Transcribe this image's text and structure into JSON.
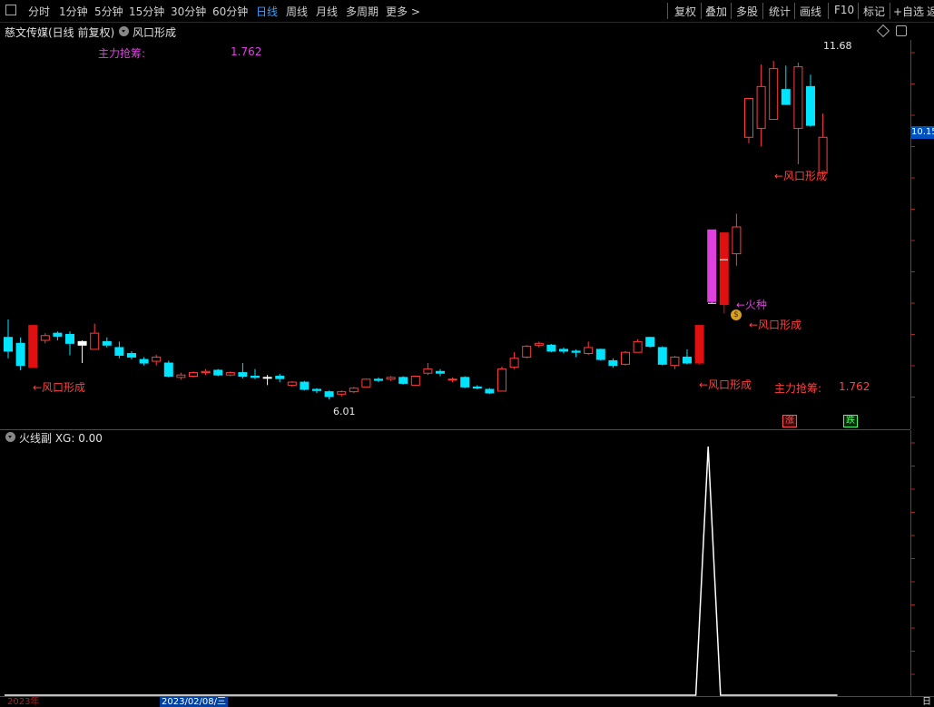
{
  "toolbar": {
    "periods": [
      "分时",
      "1分钟",
      "5分钟",
      "15分钟",
      "30分钟",
      "60分钟",
      "日线",
      "周线",
      "月线",
      "多周期",
      "更多 >"
    ],
    "active": "日线",
    "right": [
      "复权",
      "叠加",
      "多股",
      "统计",
      "画线",
      "F10",
      "标记",
      "+自选",
      "返"
    ]
  },
  "header": {
    "stock": "慈文传媒(日线 前复权)",
    "indicator": "风口形成",
    "zhuli_label": "主力抢筹:",
    "zhuli_value": "1.762"
  },
  "main_annotations": {
    "high_label": "11.68",
    "low_label": "6.01",
    "fengkou": "←风口形成",
    "huozhong": "←火种",
    "zhuli_label": "主力抢筹:",
    "zhuli_value": "1.762",
    "price_tag": "10.15",
    "zhang": "涨",
    "die": "跌"
  },
  "sub_panel": {
    "title": "火线副 XG: 0.00"
  },
  "bottom_axis": {
    "date": "2023/02/08/三",
    "year": "2023年",
    "right": "日"
  },
  "colors": {
    "up": "#ff3c3c",
    "down": "#00e4ff",
    "axis": "#b02020",
    "magenta": "#e040e0",
    "label_red": "#ff4040"
  },
  "chart_data": {
    "type": "candlestick",
    "y_range": [
      5.8,
      12.0
    ],
    "candles": [
      {
        "o": 6.82,
        "c": 7.05,
        "h": 7.35,
        "l": 6.7,
        "t": "down"
      },
      {
        "o": 6.95,
        "c": 6.58,
        "h": 7.05,
        "l": 6.5,
        "t": "down"
      },
      {
        "o": 6.55,
        "c": 7.25,
        "h": 7.25,
        "l": 6.55,
        "t": "fire"
      },
      {
        "o": 7.0,
        "c": 7.08,
        "h": 7.12,
        "l": 6.95,
        "t": "up"
      },
      {
        "o": 7.12,
        "c": 7.07,
        "h": 7.15,
        "l": 7.0,
        "t": "down"
      },
      {
        "o": 7.1,
        "c": 6.95,
        "h": 7.15,
        "l": 6.75,
        "t": "down"
      },
      {
        "o": 6.98,
        "c": 6.92,
        "h": 7.0,
        "l": 6.62,
        "t": "flat"
      },
      {
        "o": 6.85,
        "c": 7.12,
        "h": 7.28,
        "l": 6.85,
        "t": "up"
      },
      {
        "o": 6.98,
        "c": 6.92,
        "h": 7.05,
        "l": 6.88,
        "t": "down"
      },
      {
        "o": 6.88,
        "c": 6.75,
        "h": 6.98,
        "l": 6.7,
        "t": "down"
      },
      {
        "o": 6.78,
        "c": 6.72,
        "h": 6.82,
        "l": 6.68,
        "t": "down"
      },
      {
        "o": 6.68,
        "c": 6.62,
        "h": 6.72,
        "l": 6.58,
        "t": "down"
      },
      {
        "o": 6.65,
        "c": 6.72,
        "h": 6.76,
        "l": 6.58,
        "t": "up"
      },
      {
        "o": 6.62,
        "c": 6.4,
        "h": 6.66,
        "l": 6.38,
        "t": "down"
      },
      {
        "o": 6.38,
        "c": 6.42,
        "h": 6.46,
        "l": 6.34,
        "t": "up"
      },
      {
        "o": 6.4,
        "c": 6.46,
        "h": 6.48,
        "l": 6.38,
        "t": "up"
      },
      {
        "o": 6.46,
        "c": 6.48,
        "h": 6.52,
        "l": 6.42,
        "t": "up"
      },
      {
        "o": 6.5,
        "c": 6.42,
        "h": 6.52,
        "l": 6.4,
        "t": "down"
      },
      {
        "o": 6.42,
        "c": 6.46,
        "h": 6.48,
        "l": 6.4,
        "t": "up"
      },
      {
        "o": 6.46,
        "c": 6.4,
        "h": 6.62,
        "l": 6.36,
        "t": "down"
      },
      {
        "o": 6.4,
        "c": 6.38,
        "h": 6.52,
        "l": 6.35,
        "t": "down"
      },
      {
        "o": 6.38,
        "c": 6.37,
        "h": 6.42,
        "l": 6.25,
        "t": "flat"
      },
      {
        "o": 6.4,
        "c": 6.36,
        "h": 6.44,
        "l": 6.3,
        "t": "down"
      },
      {
        "o": 6.3,
        "c": 6.25,
        "h": 6.32,
        "l": 6.22,
        "t": "up"
      },
      {
        "o": 6.3,
        "c": 6.18,
        "h": 6.32,
        "l": 6.16,
        "t": "down"
      },
      {
        "o": 6.18,
        "c": 6.16,
        "h": 6.2,
        "l": 6.12,
        "t": "down"
      },
      {
        "o": 6.14,
        "c": 6.06,
        "h": 6.16,
        "l": 6.01,
        "t": "down"
      },
      {
        "o": 6.1,
        "c": 6.14,
        "h": 6.16,
        "l": 6.06,
        "t": "up"
      },
      {
        "o": 6.14,
        "c": 6.2,
        "h": 6.22,
        "l": 6.12,
        "t": "up"
      },
      {
        "o": 6.22,
        "c": 6.35,
        "h": 6.36,
        "l": 6.22,
        "t": "up"
      },
      {
        "o": 6.33,
        "c": 6.35,
        "h": 6.38,
        "l": 6.3,
        "t": "down"
      },
      {
        "o": 6.35,
        "c": 6.38,
        "h": 6.4,
        "l": 6.32,
        "t": "up"
      },
      {
        "o": 6.38,
        "c": 6.28,
        "h": 6.4,
        "l": 6.26,
        "t": "down"
      },
      {
        "o": 6.25,
        "c": 6.4,
        "h": 6.4,
        "l": 6.25,
        "t": "up"
      },
      {
        "o": 6.45,
        "c": 6.52,
        "h": 6.62,
        "l": 6.42,
        "t": "up"
      },
      {
        "o": 6.48,
        "c": 6.45,
        "h": 6.52,
        "l": 6.4,
        "t": "down"
      },
      {
        "o": 6.35,
        "c": 6.34,
        "h": 6.38,
        "l": 6.3,
        "t": "up"
      },
      {
        "o": 6.38,
        "c": 6.22,
        "h": 6.4,
        "l": 6.2,
        "t": "down"
      },
      {
        "o": 6.22,
        "c": 6.2,
        "h": 6.25,
        "l": 6.18,
        "t": "down"
      },
      {
        "o": 6.18,
        "c": 6.12,
        "h": 6.2,
        "l": 6.1,
        "t": "down"
      },
      {
        "o": 6.15,
        "c": 6.52,
        "h": 6.56,
        "l": 6.15,
        "t": "up"
      },
      {
        "o": 6.55,
        "c": 6.7,
        "h": 6.8,
        "l": 6.52,
        "t": "up"
      },
      {
        "o": 6.72,
        "c": 6.9,
        "h": 6.92,
        "l": 6.7,
        "t": "up"
      },
      {
        "o": 6.92,
        "c": 6.95,
        "h": 6.98,
        "l": 6.88,
        "t": "up"
      },
      {
        "o": 6.92,
        "c": 6.82,
        "h": 6.94,
        "l": 6.8,
        "t": "down"
      },
      {
        "o": 6.85,
        "c": 6.82,
        "h": 6.88,
        "l": 6.78,
        "t": "down"
      },
      {
        "o": 6.82,
        "c": 6.8,
        "h": 6.85,
        "l": 6.72,
        "t": "down"
      },
      {
        "o": 6.78,
        "c": 6.88,
        "h": 6.98,
        "l": 6.76,
        "t": "up"
      },
      {
        "o": 6.85,
        "c": 6.68,
        "h": 6.86,
        "l": 6.66,
        "t": "down"
      },
      {
        "o": 6.66,
        "c": 6.58,
        "h": 6.7,
        "l": 6.54,
        "t": "down"
      },
      {
        "o": 6.6,
        "c": 6.8,
        "h": 6.82,
        "l": 6.58,
        "t": "up"
      },
      {
        "o": 6.8,
        "c": 6.98,
        "h": 7.02,
        "l": 6.8,
        "t": "up"
      },
      {
        "o": 7.05,
        "c": 6.9,
        "h": 7.06,
        "l": 6.88,
        "t": "down"
      },
      {
        "o": 6.88,
        "c": 6.6,
        "h": 6.9,
        "l": 6.58,
        "t": "down"
      },
      {
        "o": 6.58,
        "c": 6.72,
        "h": 6.74,
        "l": 6.52,
        "t": "up"
      },
      {
        "o": 6.72,
        "c": 6.62,
        "h": 6.85,
        "l": 6.6,
        "t": "down"
      },
      {
        "o": 6.62,
        "c": 7.25,
        "h": 7.25,
        "l": 6.6,
        "t": "fire"
      },
      {
        "o": 7.65,
        "c": 8.85,
        "h": 8.85,
        "l": 7.62,
        "t": "magenta"
      },
      {
        "o": 8.8,
        "c": 7.6,
        "h": 8.8,
        "l": 7.45,
        "t": "fire"
      },
      {
        "o": 8.45,
        "c": 8.9,
        "h": 9.12,
        "l": 8.25,
        "t": "up"
      },
      {
        "o": 10.4,
        "c": 11.05,
        "h": 11.05,
        "l": 10.3,
        "t": "up"
      },
      {
        "o": 10.55,
        "c": 11.25,
        "h": 11.62,
        "l": 10.25,
        "t": "up"
      },
      {
        "o": 10.7,
        "c": 11.55,
        "h": 11.68,
        "l": 10.7,
        "t": "up"
      },
      {
        "o": 11.2,
        "c": 10.95,
        "h": 11.6,
        "l": 10.95,
        "t": "down"
      },
      {
        "o": 10.55,
        "c": 11.58,
        "h": 11.65,
        "l": 9.95,
        "t": "up"
      },
      {
        "o": 11.25,
        "c": 10.6,
        "h": 11.45,
        "l": 10.58,
        "t": "down"
      },
      {
        "o": 10.4,
        "c": 9.8,
        "h": 10.8,
        "l": 9.78,
        "t": "up"
      }
    ],
    "signal_line": [
      0,
      0,
      0,
      0,
      0,
      0,
      0,
      0,
      0,
      0,
      0,
      0,
      0,
      0,
      0,
      0,
      0,
      0,
      0,
      0,
      0,
      0,
      0,
      0,
      0,
      0,
      0,
      0,
      0,
      0,
      0,
      0,
      0,
      0,
      0,
      0,
      0,
      0,
      0,
      0,
      0,
      0,
      0,
      0,
      0,
      0,
      0,
      0,
      0,
      0,
      0,
      0,
      0,
      0,
      0,
      0,
      0,
      1,
      0,
      0,
      0,
      0,
      0,
      0,
      0,
      0,
      0
    ]
  }
}
